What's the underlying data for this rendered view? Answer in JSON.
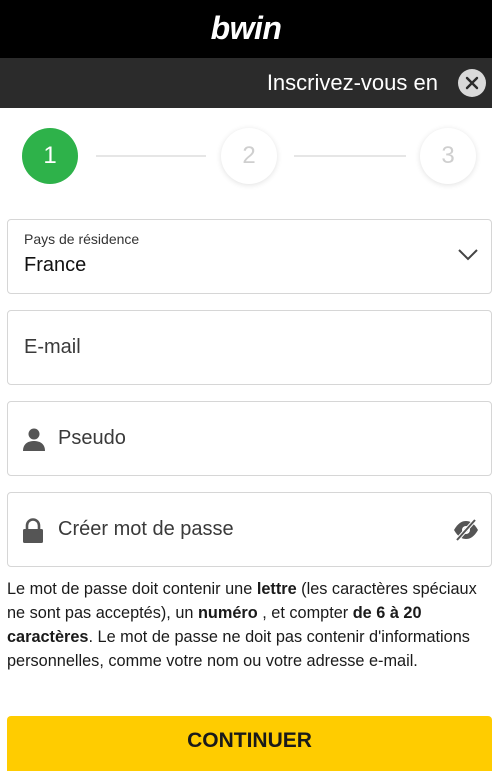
{
  "header": {
    "logo": "bwin"
  },
  "titlebar": {
    "title": "Inscrivez-vous en"
  },
  "stepper": {
    "steps": [
      "1",
      "2",
      "3"
    ],
    "active_step": 1
  },
  "form": {
    "country": {
      "label": "Pays de résidence",
      "value": "France"
    },
    "email": {
      "placeholder": "E-mail"
    },
    "pseudo": {
      "placeholder": "Pseudo"
    },
    "password": {
      "placeholder": "Créer mot de passe"
    }
  },
  "help_text": {
    "p1": "Le mot de passe doit contenir une ",
    "b1": "lettre",
    "p2": " (les caractères spéciaux ne sont pas acceptés), un ",
    "b2": "numéro",
    "p3": " , et compter ",
    "b3": "de 6 à 20 caractères",
    "p4": ". Le mot de passe ne doit pas contenir d'informations personnelles, comme votre nom ou votre adresse e-mail."
  },
  "cta": {
    "label": "CONTINUER"
  },
  "colors": {
    "brand_black": "#000000",
    "titlebar": "#2b2b2b",
    "step_active": "#2eb24a",
    "cta_yellow": "#ffcc00"
  },
  "icons": [
    "close-icon",
    "chevron-down-icon",
    "user-icon",
    "lock-icon",
    "eye-off-icon"
  ]
}
